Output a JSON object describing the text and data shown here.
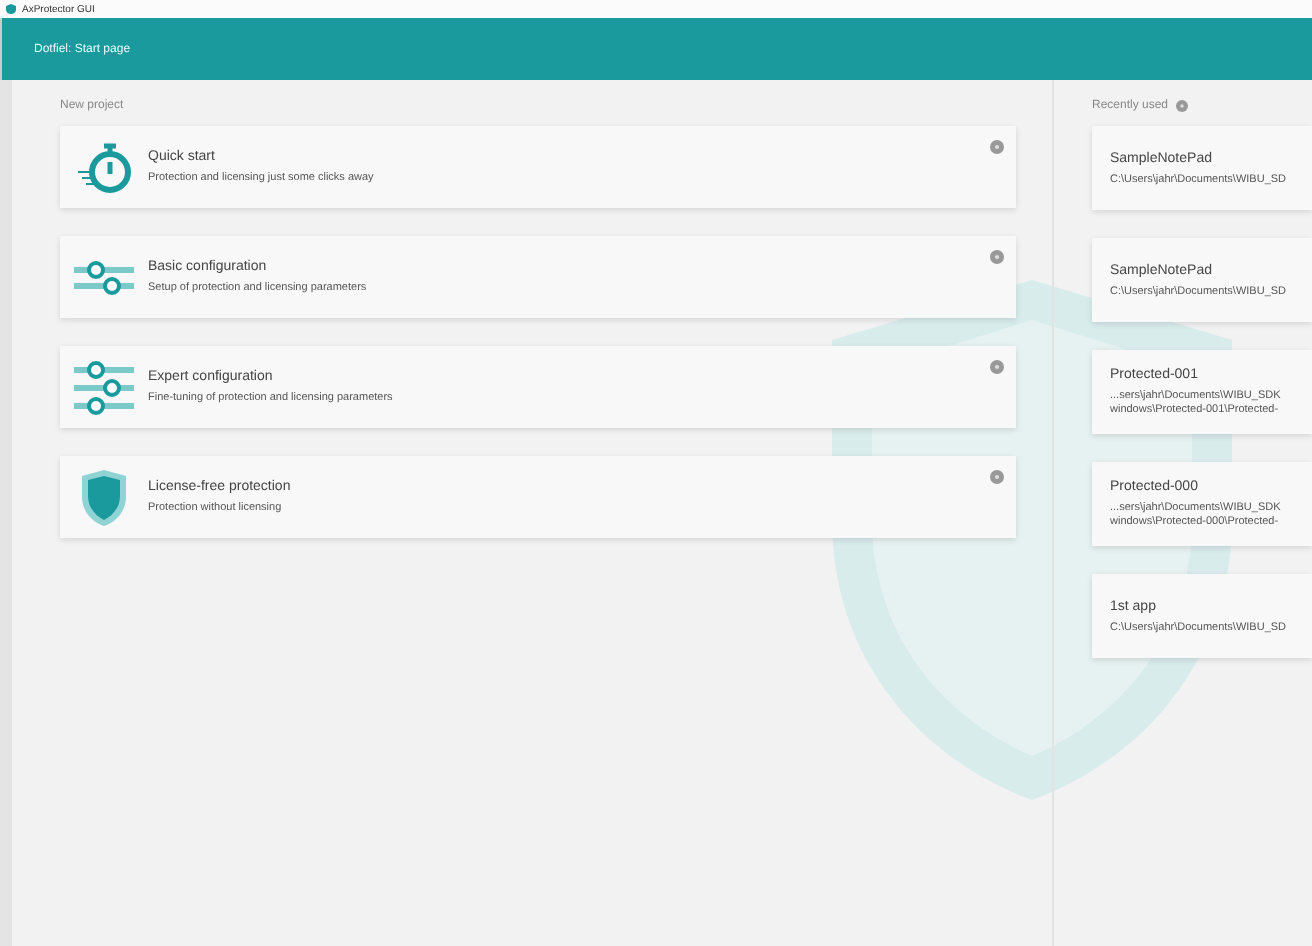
{
  "window": {
    "title": "AxProtector GUI"
  },
  "header": {
    "title": "Dotfiel: Start page"
  },
  "new_project": {
    "label": "New project",
    "items": [
      {
        "kind": "stopwatch",
        "title": "Quick start",
        "subtitle": "Protection and licensing just some clicks away"
      },
      {
        "kind": "sliders2",
        "title": "Basic configuration",
        "subtitle": "Setup of protection and licensing parameters"
      },
      {
        "kind": "sliders3",
        "title": "Expert configuration",
        "subtitle": "Fine-tuning of protection and licensing parameters"
      },
      {
        "kind": "shield",
        "title": "License-free protection",
        "subtitle": "Protection without licensing"
      }
    ]
  },
  "recently_used": {
    "label": "Recently used",
    "items": [
      {
        "name": "SampleNotePad",
        "path": [
          "C:\\Users\\jahr\\Documents\\WIBU_SD"
        ]
      },
      {
        "name": "SampleNotePad",
        "path": [
          "C:\\Users\\jahr\\Documents\\WIBU_SD"
        ]
      },
      {
        "name": "Protected-001",
        "path": [
          "...sers\\jahr\\Documents\\WIBU_SDK",
          "windows\\Protected-001\\Protected-"
        ]
      },
      {
        "name": "Protected-000",
        "path": [
          "...sers\\jahr\\Documents\\WIBU_SDK",
          "windows\\Protected-000\\Protected-"
        ]
      },
      {
        "name": "1st app",
        "path": [
          "C:\\Users\\jahr\\Documents\\WIBU_SD"
        ]
      }
    ]
  }
}
